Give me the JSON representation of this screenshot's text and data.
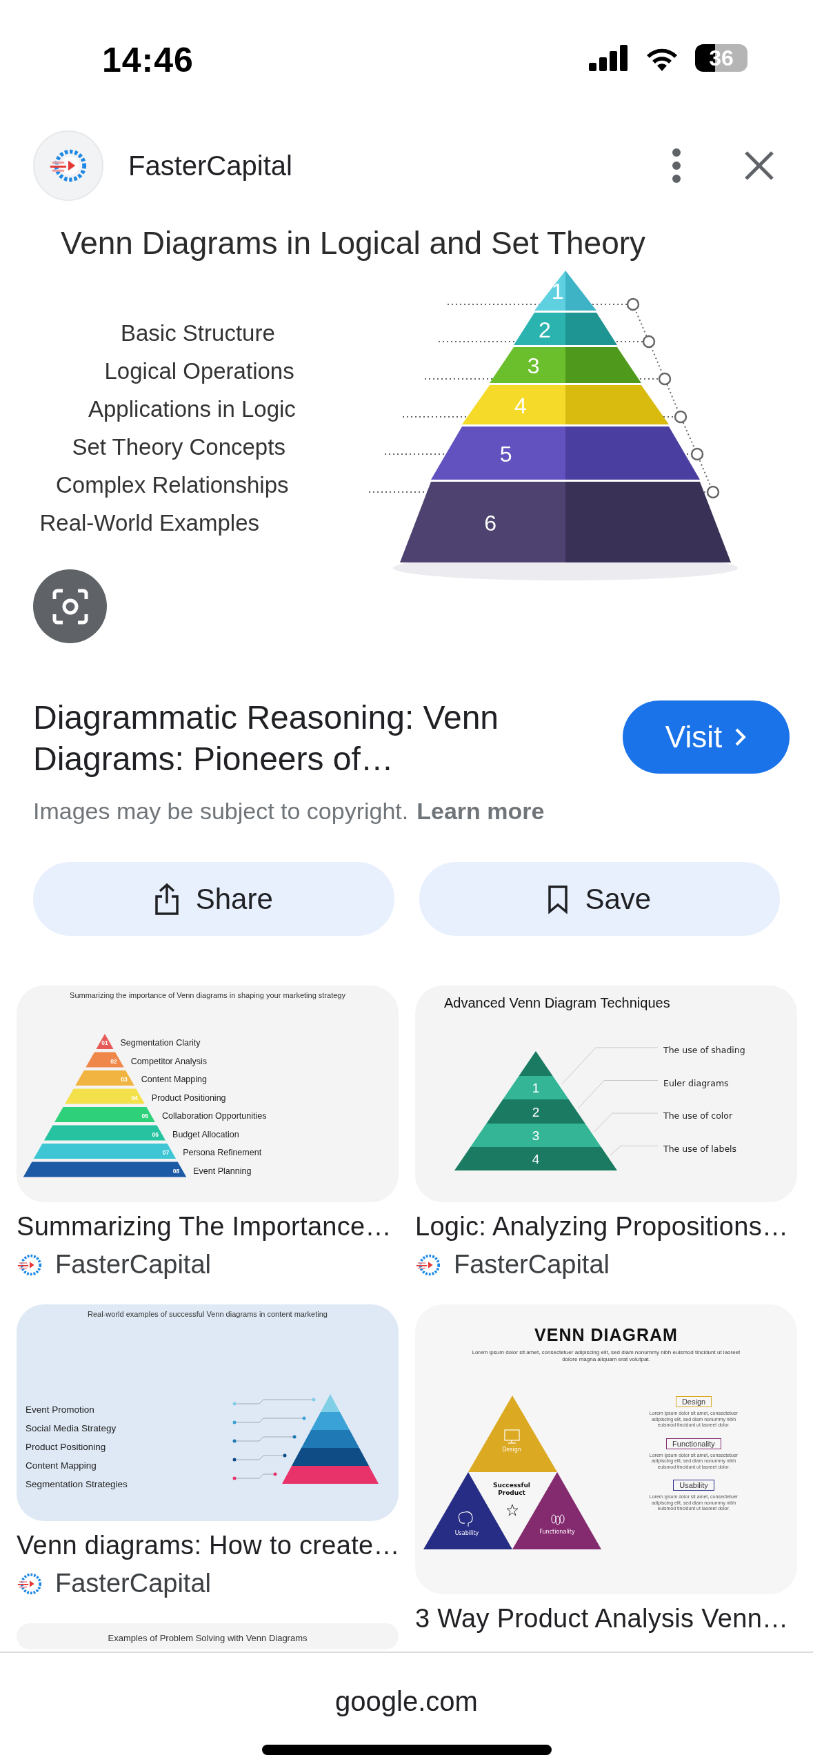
{
  "status_bar": {
    "time": "14:46",
    "battery": "36"
  },
  "header": {
    "source": "FasterCapital"
  },
  "main_image": {
    "title": "Venn Diagrams in Logical and Set Theory",
    "items": [
      "Basic Structure",
      "Logical Operations",
      "Applications in Logic",
      "Set Theory Concepts",
      "Complex Relationships",
      "Real-World Examples"
    ],
    "tiers": [
      "1",
      "2",
      "3",
      "4",
      "5",
      "6"
    ]
  },
  "result": {
    "title": "Diagrammatic Reasoning: Venn Diagrams: Pioneers of…",
    "visit": "Visit",
    "notice": "Images may be subject to copyright.",
    "link": "Learn more"
  },
  "actions": [
    {
      "kind": "share",
      "label": "Share"
    },
    {
      "kind": "save",
      "label": "Save"
    }
  ],
  "related": {
    "columns": [
      [
        {
          "kind": "pyramid-list",
          "title": "Summarizing The Importance…",
          "source": "FasterCapital",
          "image": {
            "header": "Summarizing the importance of Venn diagrams in shaping your marketing strategy",
            "numbers": [
              "01",
              "02",
              "03",
              "04",
              "05",
              "06",
              "07",
              "08"
            ],
            "labels": [
              "Segmentation Clarity",
              "Competitor Analysis",
              "Content Mapping",
              "Product Positioning",
              "Collaboration Opportunities",
              "Budget Allocation",
              "Persona Refinement",
              "Event Planning"
            ]
          }
        },
        {
          "kind": "pyramid-side",
          "title": "Venn diagrams: How to create…",
          "source": "FasterCapital",
          "image": {
            "header": "Real-world examples of successful Venn diagrams in content marketing",
            "labels": [
              "Event Promotion",
              "Social Media Strategy",
              "Product Positioning",
              "Content Mapping",
              "Segmentation Strategies"
            ]
          }
        },
        {
          "kind": "partial",
          "image": {
            "header": "Examples of Problem Solving with Venn Diagrams"
          }
        }
      ],
      [
        {
          "kind": "pyramid-numbered",
          "title": "Logic: Analyzing Propositions…",
          "source": "FasterCapital",
          "image": {
            "header": "Advanced Venn Diagram Techniques",
            "numbers": [
              "1",
              "2",
              "3",
              "4"
            ],
            "labels": [
              "The use of shading",
              "Euler diagrams",
              "The use of color",
              "The use of labels"
            ]
          }
        },
        {
          "kind": "venn-triangle",
          "title": "3 Way Product Analysis Venn…",
          "image": {
            "header": "VENN DIAGRAM",
            "intro": "Lorem ipsum dolor sit amet, consectetuer adipiscing elit, sed diam nonummy nibh euismod tincidunt ut laoreet dolore magna aliquam erat volutpat.",
            "center": "Successful Product",
            "triangles": [
              {
                "label": "Design",
                "color": "#dca922"
              },
              {
                "label": "Usability",
                "color": "#272c84"
              },
              {
                "label": "Functionality",
                "color": "#842a6f"
              }
            ],
            "parts": [
              {
                "label": "Design",
                "text": "Lorem ipsum dolor sit amet, consectetuer adipiscing elit, sed diam nonummy nibh euismod tincidunt ut laoreet dolor.",
                "color": "#dca922"
              },
              {
                "label": "Functionality",
                "text": "Lorem ipsum dolor sit amet, consectetuer adipiscing elit, sed diam nonummy nibh euismod tincidunt ut laoreet dolor.",
                "color": "#842a6f"
              },
              {
                "label": "Usability",
                "text": "Lorem ipsum dolor sit amet, consectetuer adipiscing elit, sed diam nonummy nibh euismod tincidunt ut laoreet dolor.",
                "color": "#272c84"
              }
            ]
          }
        }
      ]
    ]
  },
  "footer": {
    "domain": "google.com"
  }
}
